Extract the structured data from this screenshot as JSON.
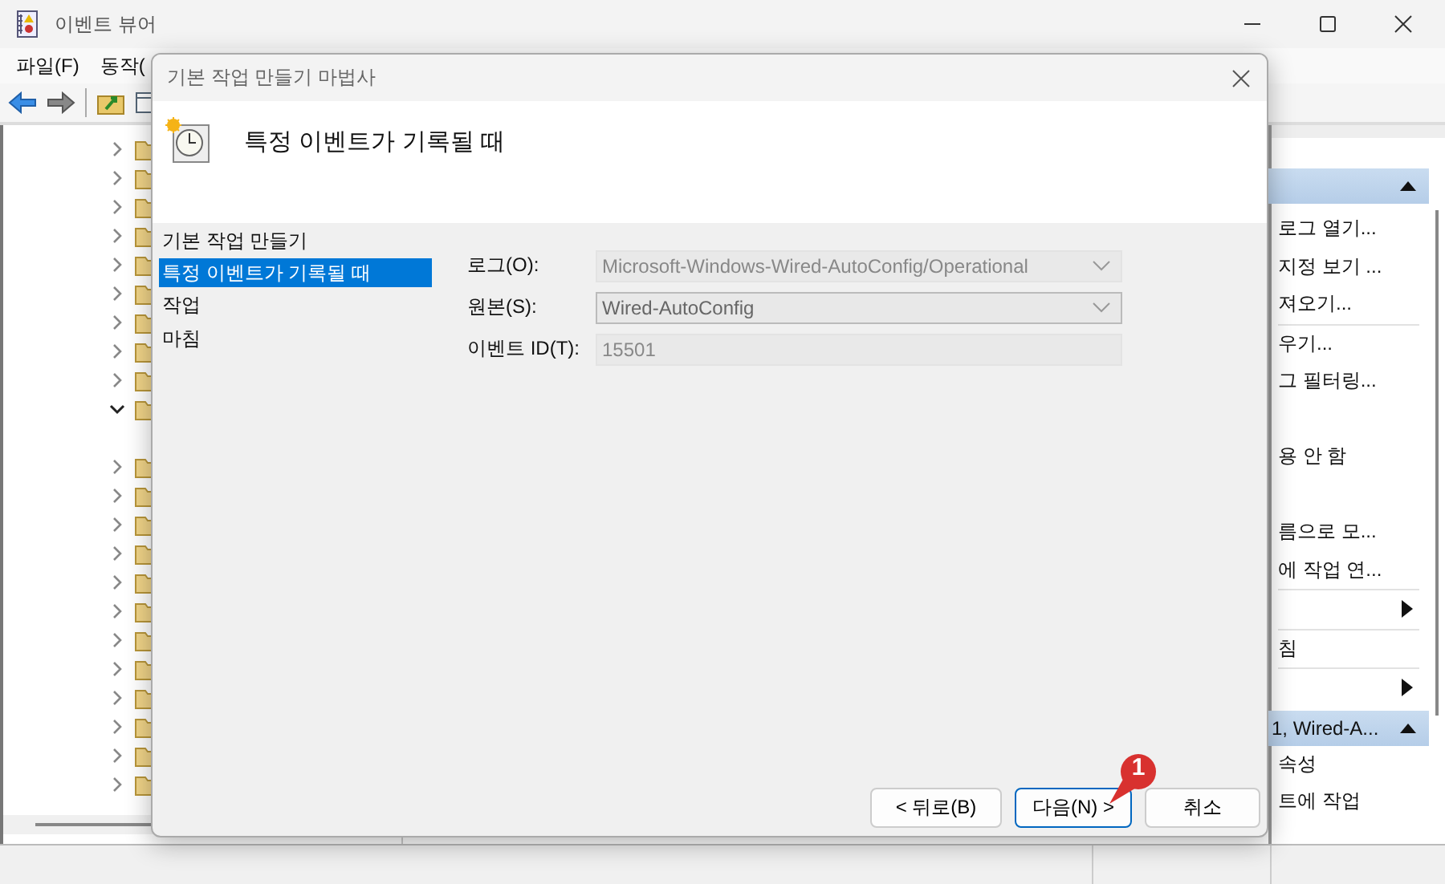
{
  "window": {
    "title": "이벤트 뷰어"
  },
  "menu": [
    "파일(F)",
    "동작("
  ],
  "tree_nodes": [
    {
      "expanded": false
    },
    {
      "expanded": false
    },
    {
      "expanded": false
    },
    {
      "expanded": false
    },
    {
      "expanded": false
    },
    {
      "expanded": false
    },
    {
      "expanded": false
    },
    {
      "expanded": false
    },
    {
      "expanded": false
    },
    {
      "expanded": true
    },
    {
      "expanded": false
    },
    {
      "expanded": false
    },
    {
      "expanded": false
    },
    {
      "expanded": false
    },
    {
      "expanded": false
    },
    {
      "expanded": false
    },
    {
      "expanded": false
    },
    {
      "expanded": false
    },
    {
      "expanded": false
    },
    {
      "expanded": false
    },
    {
      "expanded": false
    },
    {
      "expanded": false
    }
  ],
  "actions": [
    {
      "kind": "header",
      "expanded": true
    },
    {
      "kind": "item",
      "label": "로그 열기..."
    },
    {
      "kind": "item",
      "label": "지정 보기 ..."
    },
    {
      "kind": "item",
      "label": "져오기..."
    },
    {
      "kind": "separator"
    },
    {
      "kind": "item",
      "label": "우기..."
    },
    {
      "kind": "item",
      "label": "그 필터링..."
    },
    {
      "kind": "blank"
    },
    {
      "kind": "item",
      "label": "용 안 함"
    },
    {
      "kind": "blank"
    },
    {
      "kind": "item",
      "label": "름으로 모..."
    },
    {
      "kind": "item",
      "label": "에 작업 연..."
    },
    {
      "kind": "separator"
    },
    {
      "kind": "submenu"
    },
    {
      "kind": "separator"
    },
    {
      "kind": "item",
      "label": "침"
    },
    {
      "kind": "separator"
    },
    {
      "kind": "submenu"
    },
    {
      "kind": "header",
      "label": "1, Wired-A...",
      "expanded": true
    },
    {
      "kind": "item",
      "label": "속성"
    },
    {
      "kind": "item",
      "label": "트에 작업"
    }
  ],
  "dialog": {
    "title": "기본 작업 만들기 마법사",
    "heading": "특정 이벤트가 기록될 때",
    "steps": [
      {
        "label": "기본 작업 만들기",
        "selected": false
      },
      {
        "label": "특정 이벤트가 기록될 때",
        "selected": true
      },
      {
        "label": "작업",
        "selected": false
      },
      {
        "label": "마침",
        "selected": false
      }
    ],
    "fields": [
      {
        "label": "로그(O):",
        "value": "Microsoft-Windows-Wired-AutoConfig/Operational",
        "kind": "combo",
        "disabled": true
      },
      {
        "label": "원본(S):",
        "value": "Wired-AutoConfig",
        "kind": "combo",
        "disabled": false
      },
      {
        "label": "이벤트 ID(T):",
        "value": "15501",
        "kind": "text",
        "disabled": true
      }
    ],
    "buttons": [
      {
        "label": "< 뒤로(B)",
        "focused": false
      },
      {
        "label": "다음(N) >",
        "focused": true
      },
      {
        "label": "취소",
        "focused": false
      }
    ],
    "callout": "1"
  }
}
